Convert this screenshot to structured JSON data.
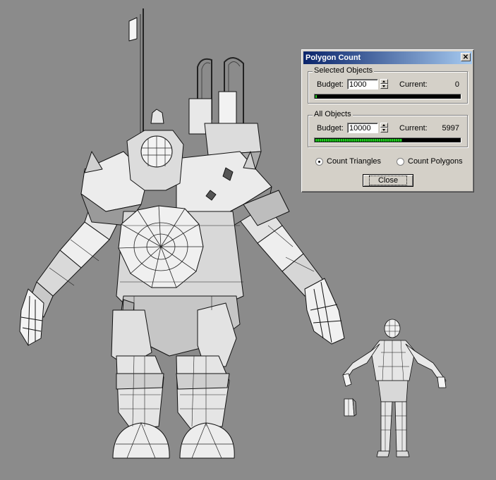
{
  "dialog": {
    "title": "Polygon Count",
    "close_glyph": "✕",
    "selected_objects": {
      "group_label": "Selected Objects",
      "budget_label": "Budget:",
      "budget_value": "1000",
      "current_label": "Current:",
      "current_value": "0",
      "meter_fraction": 0.01
    },
    "all_objects": {
      "group_label": "All Objects",
      "budget_label": "Budget:",
      "budget_value": "10000",
      "current_label": "Current:",
      "current_value": "5997",
      "meter_fraction": 0.6
    },
    "count_mode": {
      "triangles_label": "Count Triangles",
      "polygons_label": "Count Polygons",
      "selected": "triangles"
    },
    "close_button_label": "Close"
  },
  "viewport": {
    "background_color": "#8b8b8b",
    "models": [
      "armored-robot-model",
      "small-humanoid-model",
      "small-prop-model"
    ]
  }
}
